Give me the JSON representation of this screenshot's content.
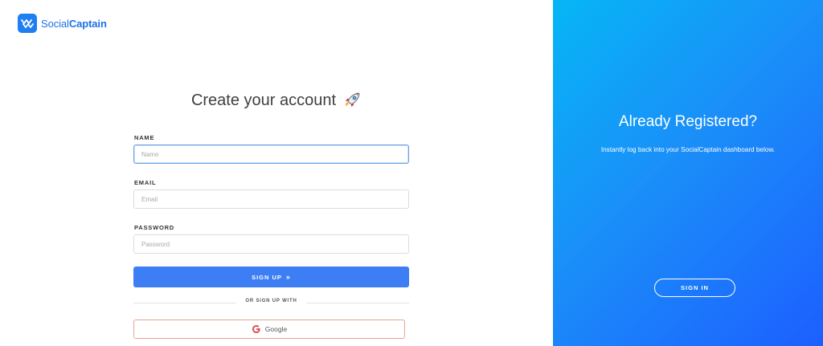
{
  "brand": {
    "name_part1": "Social",
    "name_part2": "Captain",
    "color": "#1e7ff2"
  },
  "signup": {
    "title": "Create your account",
    "title_icon": "rocket-icon",
    "name_label": "NAME",
    "name_placeholder": "Name",
    "email_label": "EMAIL",
    "email_placeholder": "Email",
    "password_label": "PASSWORD",
    "password_placeholder": "Password",
    "submit_label": "SIGN UP",
    "submit_icon": "double-chevron-right-icon",
    "divider_text": "OR SIGN UP WITH",
    "google_label": "Google",
    "google_icon": "google-g-icon",
    "accent": "#3d7ef5"
  },
  "signin_panel": {
    "title": "Already Registered?",
    "description": "Instantly log back into your SocialCaptain dashboard below.",
    "button_label": "SIGN IN",
    "gradient_start": "#06b6f6",
    "gradient_end": "#1d5fff"
  }
}
